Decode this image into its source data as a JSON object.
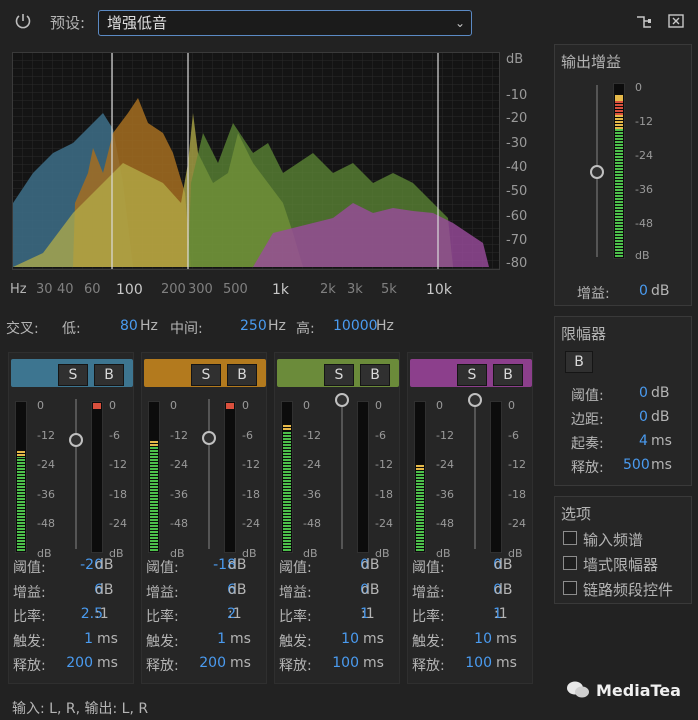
{
  "toolbar": {
    "preset_label": "预设:",
    "preset_value": "增强低音",
    "power_icon": "power-icon",
    "routing_icon": "routing-icon",
    "window_icon": "window-icon"
  },
  "spectrum": {
    "db_labels": [
      "dB",
      "-10",
      "-20",
      "-30",
      "-40",
      "-50",
      "-60",
      "-70",
      "-80"
    ],
    "freq_labels": [
      "Hz",
      "30",
      "40",
      "60",
      "100",
      "200",
      "300",
      "500",
      "1k",
      "2k",
      "3k",
      "5k",
      "10k"
    ],
    "crossover_lines_hz": [
      80,
      250,
      10000
    ]
  },
  "crossover": {
    "title": "交叉:",
    "low_label": "低:",
    "low_value": "80",
    "low_unit": "Hz",
    "mid_label": "中间:",
    "mid_value": "250",
    "mid_unit": "Hz",
    "high_label": "高:",
    "high_value": "10000",
    "high_unit": "Hz"
  },
  "output": {
    "title": "输出增益",
    "ticks": [
      "0",
      "-12",
      "-24",
      "-36",
      "-48",
      "dB"
    ],
    "gain_label": "增益:",
    "gain_value": "0",
    "gain_unit": "dB"
  },
  "limiter": {
    "title": "限幅器",
    "bypass": "B",
    "threshold_label": "阈值:",
    "threshold_value": "0",
    "threshold_unit": "dB",
    "margin_label": "边距:",
    "margin_value": "0",
    "margin_unit": "dB",
    "attack_label": "起奏:",
    "attack_value": "4",
    "attack_unit": "ms",
    "release_label": "释放:",
    "release_value": "500",
    "release_unit": "ms"
  },
  "options": {
    "title": "选项",
    "item1": "输入频谱",
    "item2": "墙式限幅器",
    "item3": "链路频段控件"
  },
  "band_common": {
    "solo": "S",
    "bypass": "B",
    "input_ticks": [
      "0",
      "-12",
      "-24",
      "-36",
      "-48",
      "dB"
    ],
    "gr_ticks": [
      "0",
      "-6",
      "-12",
      "-18",
      "-24",
      "dB"
    ],
    "threshold_label": "阈值:",
    "gain_label": "增益:",
    "ratio_label": "比率:",
    "attack_label": "触发:",
    "release_label": "释放:",
    "db_unit": "dB",
    "ratio_unit": ":1",
    "ms_unit": "ms"
  },
  "bands": [
    {
      "color": "#3d7590",
      "threshold": "-20",
      "gain": "6",
      "ratio": "2.5",
      "attack": "1",
      "release": "200"
    },
    {
      "color": "#b37a1e",
      "threshold": "-18",
      "gain": "6",
      "ratio": "2",
      "attack": "1",
      "release": "200"
    },
    {
      "color": "#6b8b3a",
      "threshold": "0",
      "gain": "0",
      "ratio": "1",
      "attack": "10",
      "release": "100"
    },
    {
      "color": "#8c3f8c",
      "threshold": "0",
      "gain": "0",
      "ratio": "1",
      "attack": "10",
      "release": "100"
    }
  ],
  "footer": {
    "io": "输入: L, R,  输出: L, R",
    "brand": "MediaTea"
  }
}
